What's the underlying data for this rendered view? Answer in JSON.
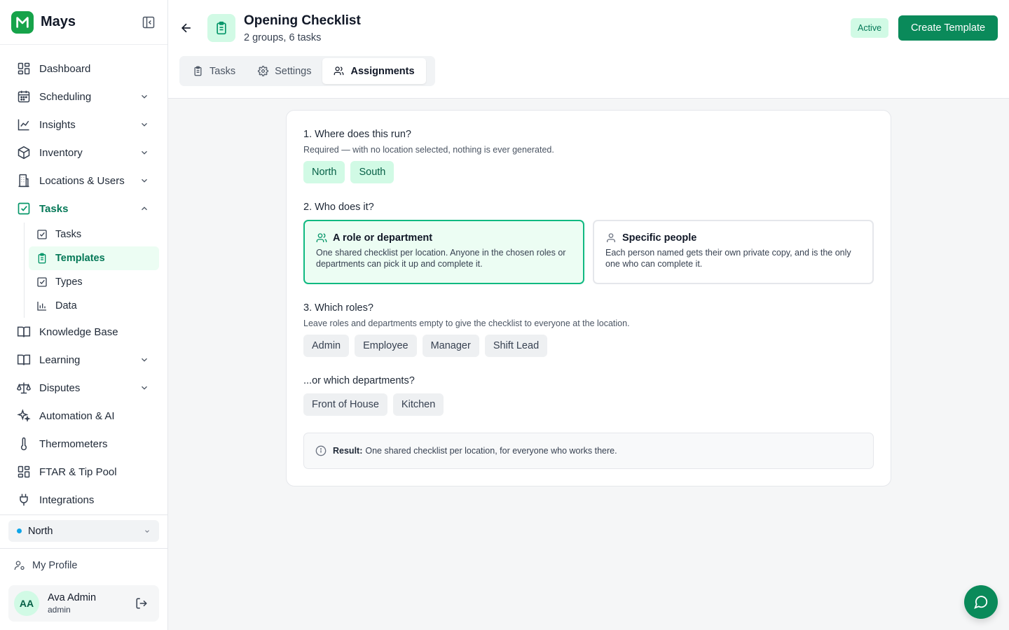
{
  "app": {
    "name": "Mays"
  },
  "sidebar": {
    "items": [
      {
        "label": "Dashboard",
        "icon": "dashboard-grid-icon"
      },
      {
        "label": "Scheduling",
        "icon": "calendar-icon",
        "expandable": true
      },
      {
        "label": "Insights",
        "icon": "line-chart-icon",
        "expandable": true
      },
      {
        "label": "Inventory",
        "icon": "box-icon",
        "expandable": true
      },
      {
        "label": "Locations & Users",
        "icon": "building-icon",
        "expandable": true
      },
      {
        "label": "Tasks",
        "icon": "checkbox-icon",
        "expandable": true,
        "expanded": true
      },
      {
        "label": "Knowledge Base",
        "icon": "book-icon"
      },
      {
        "label": "Learning",
        "icon": "book-open-icon",
        "expandable": true
      },
      {
        "label": "Disputes",
        "icon": "scales-icon",
        "expandable": true
      },
      {
        "label": "Automation & AI",
        "icon": "sparkles-icon"
      },
      {
        "label": "Thermometers",
        "icon": "thermometer-icon"
      },
      {
        "label": "FTAR & Tip Pool",
        "icon": "grid-icon"
      },
      {
        "label": "Integrations",
        "icon": "plug-icon"
      }
    ],
    "tasks_sub": [
      {
        "label": "Tasks",
        "icon": "checkbox-icon"
      },
      {
        "label": "Templates",
        "icon": "clipboard-icon",
        "selected": true
      },
      {
        "label": "Types",
        "icon": "checkbox-icon"
      },
      {
        "label": "Data",
        "icon": "bar-chart-icon"
      }
    ],
    "location": "North",
    "my_profile": "My Profile",
    "user": {
      "initials": "AA",
      "name": "Ava Admin",
      "role": "admin"
    }
  },
  "header": {
    "title": "Opening Checklist",
    "subtitle": "2 groups, 6 tasks",
    "status": "Active",
    "create_button": "Create Template",
    "tabs": [
      {
        "label": "Tasks",
        "icon": "clipboard-icon"
      },
      {
        "label": "Settings",
        "icon": "gear-icon"
      },
      {
        "label": "Assignments",
        "icon": "users-icon",
        "active": true
      }
    ]
  },
  "assignments": {
    "where": {
      "title": "1. Where does this run?",
      "help": "Required — with no location selected, nothing is ever generated.",
      "locations": [
        "North",
        "South"
      ]
    },
    "who": {
      "title": "2. Who does it?",
      "options": [
        {
          "title": "A role or department",
          "desc": "One shared checklist per location. Anyone in the chosen roles or departments can pick it up and complete it.",
          "selected": true
        },
        {
          "title": "Specific people",
          "desc": "Each person named gets their own private copy, and is the only one who can complete it.",
          "selected": false
        }
      ]
    },
    "roles": {
      "title": "3. Which roles?",
      "help": "Leave roles and departments empty to give the checklist to everyone at the location.",
      "items": [
        "Admin",
        "Employee",
        "Manager",
        "Shift Lead"
      ]
    },
    "departments": {
      "title": "...or which departments?",
      "items": [
        "Front of House",
        "Kitchen"
      ]
    },
    "result": {
      "label": "Result:",
      "text": "One shared checklist per location, for everyone who works there."
    }
  },
  "colors": {
    "accent": "#0a8a5a",
    "accent_light": "#d1fae5",
    "selected_border": "#10b981"
  }
}
